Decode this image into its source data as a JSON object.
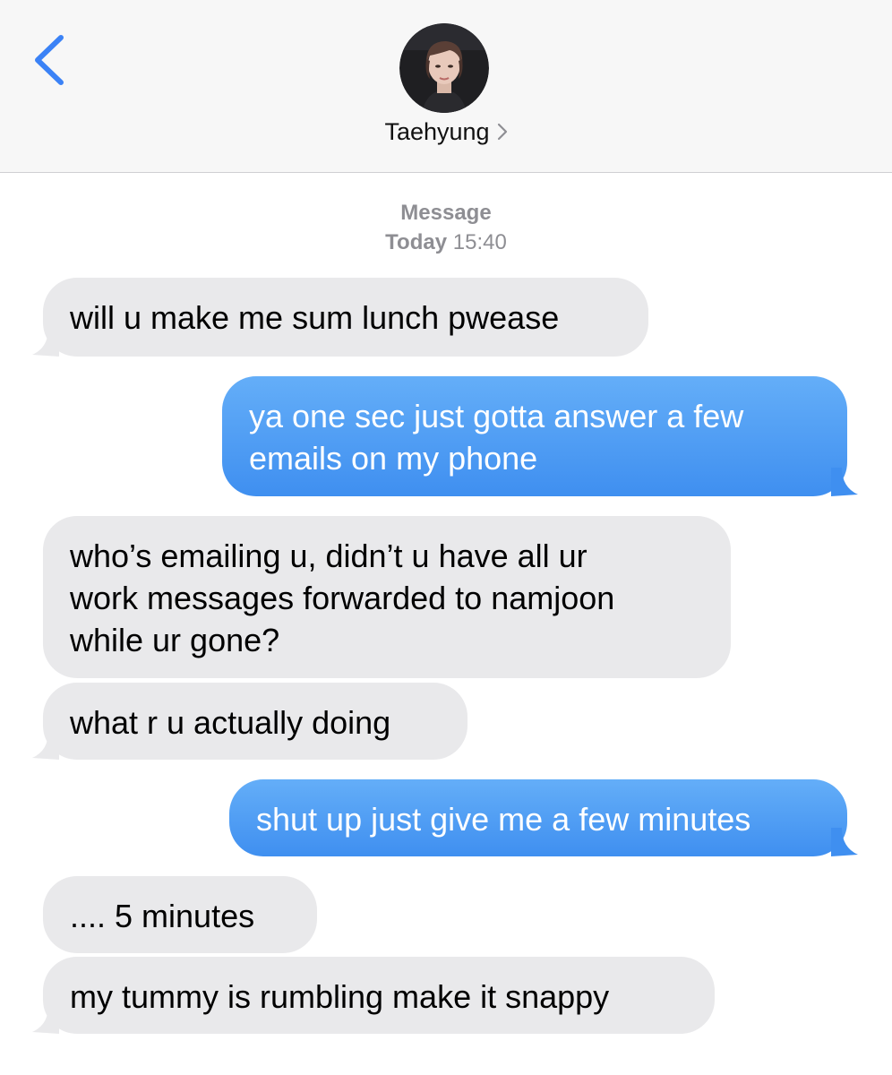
{
  "header": {
    "contact_name": "Taehyung",
    "back_icon": "chevron-left-icon",
    "chevron": "chevron-right-icon",
    "accent_color": "#3b82f6"
  },
  "thread": {
    "service_label": "Message",
    "day_label": "Today",
    "time_label": "15:40"
  },
  "messages": [
    {
      "from": "them",
      "lines": [
        "will u make me sum lunch pwease"
      ]
    },
    {
      "from": "me",
      "lines": [
        "ya one sec just gotta answer a few",
        "emails on my phone"
      ]
    },
    {
      "from": "them",
      "lines": [
        "who’s emailing u, didn’t u have all ur",
        "work messages forwarded to namjoon",
        "while ur gone?"
      ]
    },
    {
      "from": "them",
      "lines": [
        "what r u actually doing"
      ]
    },
    {
      "from": "me",
      "lines": [
        "shut up just give me a few minutes"
      ]
    },
    {
      "from": "them",
      "lines": [
        ".... 5 minutes"
      ]
    },
    {
      "from": "them",
      "lines": [
        "my tummy is rumbling make it snappy"
      ]
    }
  ],
  "colors": {
    "incoming_bubble": "#e9e9eb",
    "outgoing_bubble": "#4a98f3",
    "header_bg": "#f7f7f7"
  }
}
